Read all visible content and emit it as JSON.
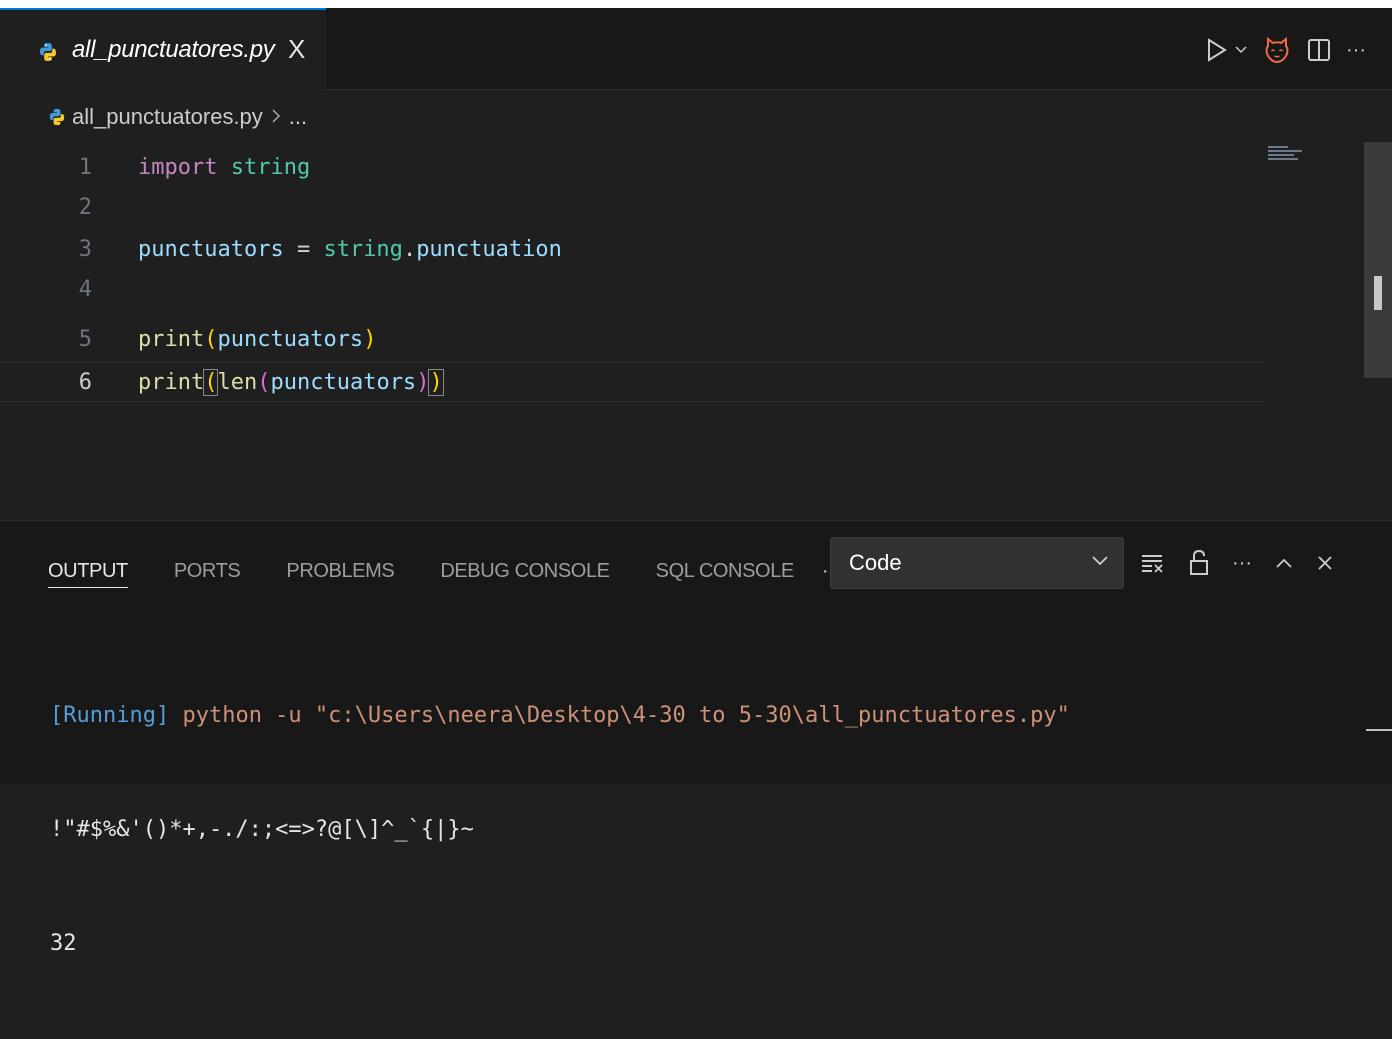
{
  "tab": {
    "filename": "all_punctuatores.py",
    "close": "X"
  },
  "tab_actions": {
    "more": "···"
  },
  "breadcrumb": {
    "file": "all_punctuatores.py",
    "ellipsis": "..."
  },
  "editor": {
    "line_numbers": [
      "1",
      "2",
      "3",
      "4",
      "5",
      "6"
    ],
    "line1": {
      "kw": "import",
      "mod": "string"
    },
    "line3": {
      "var": "punctuators",
      "eq": "=",
      "mod": "string",
      "dot": ".",
      "attr": "punctuation"
    },
    "line5": {
      "fn": "print",
      "open": "(",
      "arg": "punctuators",
      "close": ")"
    },
    "line6": {
      "fn": "print",
      "open": "(",
      "fn2": "len",
      "open2": "(",
      "arg": "punctuators",
      "close2": ")",
      "close": ")"
    }
  },
  "panel": {
    "tabs": [
      "OUTPUT",
      "PORTS",
      "PROBLEMS",
      "DEBUG CONSOLE",
      "SQL CONSOLE"
    ],
    "more": "···",
    "select_value": "Code",
    "actions_more": "···"
  },
  "output": {
    "running_tag": "[Running]",
    "command": " python -u \"c:\\Users\\neera\\Desktop\\4-30 to 5-30\\all_punctuatores.py\"",
    "punctuation_line": "!\"#$%&'()*+,-./:;<=>?@[\\]^_`{|}~",
    "length_line": "32"
  }
}
